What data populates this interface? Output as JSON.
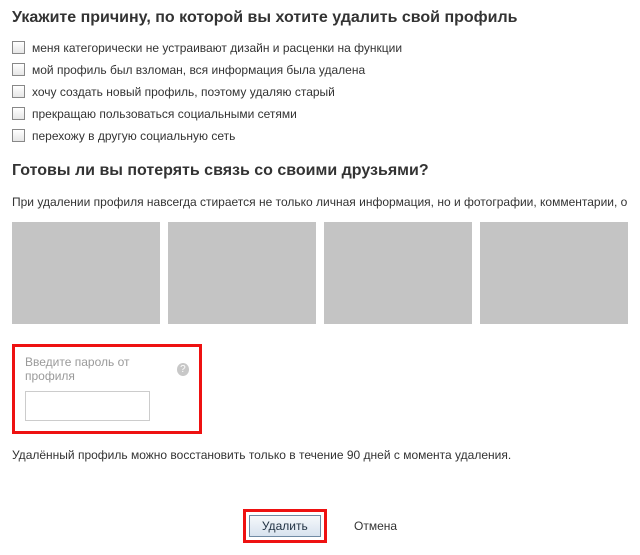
{
  "headings": {
    "reason_title": "Укажите причину, по которой вы хотите удалить свой профиль",
    "friends_title": "Готовы ли вы потерять связь со своими друзьями?"
  },
  "reasons": [
    "меня категорически не устраивают дизайн и расценки на функции",
    "мой профиль был взломан, вся информация была удалена",
    "хочу создать новый профиль, поэтому удаляю старый",
    "прекращаю пользоваться социальными сетями",
    "перехожу в другую социальную сеть"
  ],
  "warning_text": "При удалении профиля навсегда стирается не только личная информация, но и фотографии, комментарии, оценки, переписка с друзьями, достижения в играх и многое другое.",
  "password": {
    "label": "Введите пароль от профиля",
    "value": ""
  },
  "restore_note": "Удалённый профиль можно восстановить только в течение 90 дней с момента удаления.",
  "buttons": {
    "delete": "Удалить",
    "cancel": "Отмена"
  },
  "help_icon_glyph": "?",
  "colors": {
    "highlight_border": "#e11"
  }
}
